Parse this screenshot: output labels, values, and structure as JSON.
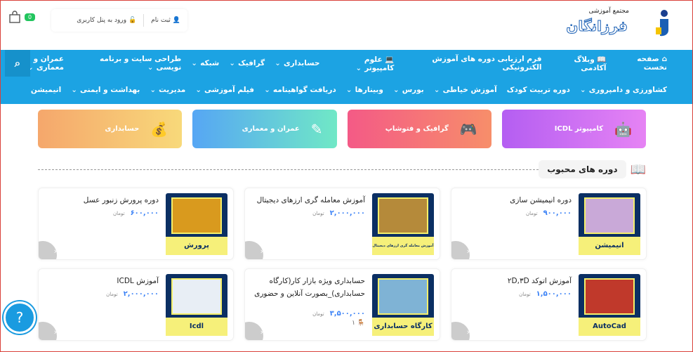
{
  "header": {
    "logo_subtitle": "مجتمع آموزشی",
    "logo_name": "فرزانگان",
    "register": "ثبت نام",
    "login": "ورود به پنل کاربری",
    "cart_count": "0"
  },
  "nav": {
    "row1": [
      {
        "label": "صفحه نخست",
        "icon": "home-icon"
      },
      {
        "label": "وبلاگ آکادمی",
        "icon": "book-icon"
      },
      {
        "label": "فرم ارزیابی دوره های آموزش الکترونیکی"
      },
      {
        "label": "علوم کامپیوتر",
        "icon": "laptop-icon",
        "dropdown": true
      },
      {
        "label": "حسابداری",
        "dropdown": true
      },
      {
        "label": "گرافیک",
        "dropdown": true
      },
      {
        "label": "شبکه",
        "dropdown": true
      },
      {
        "label": "طراحی سایت و برنامه نویسی",
        "dropdown": true
      },
      {
        "label": "عمران و معماری",
        "dropdown": true
      }
    ],
    "row2": [
      {
        "label": "کشاورزی و دامپروری",
        "dropdown": true
      },
      {
        "label": "دوره تربیت کودک"
      },
      {
        "label": "آموزش خیاطی",
        "dropdown": true
      },
      {
        "label": "بورس",
        "dropdown": true
      },
      {
        "label": "وبینارها",
        "dropdown": true
      },
      {
        "label": "دریافت گواهینامه",
        "dropdown": true
      },
      {
        "label": "فیلم آموزشی",
        "dropdown": true
      },
      {
        "label": "مدیریت",
        "dropdown": true
      },
      {
        "label": "بهداشت و ایمنی",
        "dropdown": true
      },
      {
        "label": "انیمیشن"
      }
    ]
  },
  "categories": [
    {
      "label": "کامپیوتر ICDL",
      "icon": "android-icon",
      "colors": [
        "#b45ef2",
        "#e683f4"
      ]
    },
    {
      "label": "گرافیک و فتوشاپ",
      "icon": "gamepad-icon",
      "colors": [
        "#f45a86",
        "#f78e6a"
      ]
    },
    {
      "label": "عمران و معماری",
      "icon": "pencil-icon",
      "colors": [
        "#56a6f4",
        "#70e8c6"
      ]
    },
    {
      "label": "حسابداری",
      "icon": "money-bag-icon",
      "colors": [
        "#f5a76c",
        "#f8d97a"
      ]
    }
  ],
  "section": {
    "title": "دوره های محبوب"
  },
  "currency": "تومان",
  "courses": [
    {
      "title": "دوره انیمیشن سازی",
      "price": "۹۰۰,۰۰۰",
      "thumb_label": "انیمیشن",
      "thumb_color": "#c9a9d8"
    },
    {
      "title": "آموزش معامله گری ارزهای دیجیتال",
      "price": "۲,۰۰۰,۰۰۰",
      "thumb_label": "آموزش معامله گری ارزهای دیجیتال",
      "thumb_color": "#b58a3a"
    },
    {
      "title": "دوره پرورش زنبور عسل",
      "price": "۶۰۰,۰۰۰",
      "thumb_label": "پرورش زنبورعسل",
      "thumb_color": "#d99a1e"
    },
    {
      "title": "آموزش اتوکد ۲D,۳D",
      "price": "۱,۵۰۰,۰۰۰",
      "thumb_label": "AutoCad",
      "thumb_color": "#c0392b"
    },
    {
      "title": "حسابداری ویژه بازار کار(کارگاه حسابداری)_بصورت آنلاین و حضوری",
      "price": "۳,۵۰۰,۰۰۰",
      "thumb_label": "کارگاه حسابداری",
      "thumb_color": "#7fb3d5",
      "seats": "۱"
    },
    {
      "title": "آموزش ICDL",
      "price": "۲,۰۰۰,۰۰۰",
      "thumb_label": "Icdl",
      "thumb_color": "#e8eef5"
    }
  ],
  "help_label": "?"
}
